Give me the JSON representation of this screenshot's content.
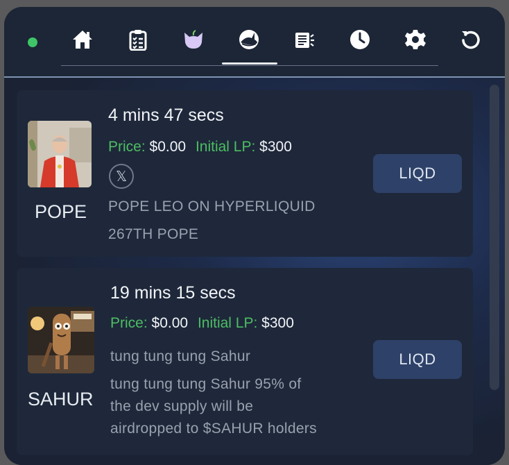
{
  "nav": {
    "status_color": "#3fc567",
    "icons": [
      "home-icon",
      "clipboard-icon",
      "cat-icon",
      "shark-icon",
      "news-icon",
      "clock-icon",
      "gear-icon",
      "refresh-icon"
    ],
    "active_index": 3
  },
  "tokens": [
    {
      "symbol": "POPE",
      "time": "4 mins 47 secs",
      "price_label": "Price:",
      "price_value": "$0.00",
      "lp_label": "Initial LP:",
      "lp_value": "$300",
      "social_icon": "x-icon",
      "social_glyph": "𝕏",
      "name": "POPE LEO ON HYPERLIQUID",
      "description": "267TH POPE",
      "button": "LIQD"
    },
    {
      "symbol": "SAHUR",
      "time": "19 mins 15 secs",
      "price_label": "Price:",
      "price_value": "$0.00",
      "lp_label": "Initial LP:",
      "lp_value": "$300",
      "name": "tung tung tung Sahur",
      "description_lines": [
        "tung tung tung Sahur 95% of",
        "the dev supply will be",
        "airdropped to $SAHUR holders"
      ],
      "button": "LIQD"
    }
  ]
}
